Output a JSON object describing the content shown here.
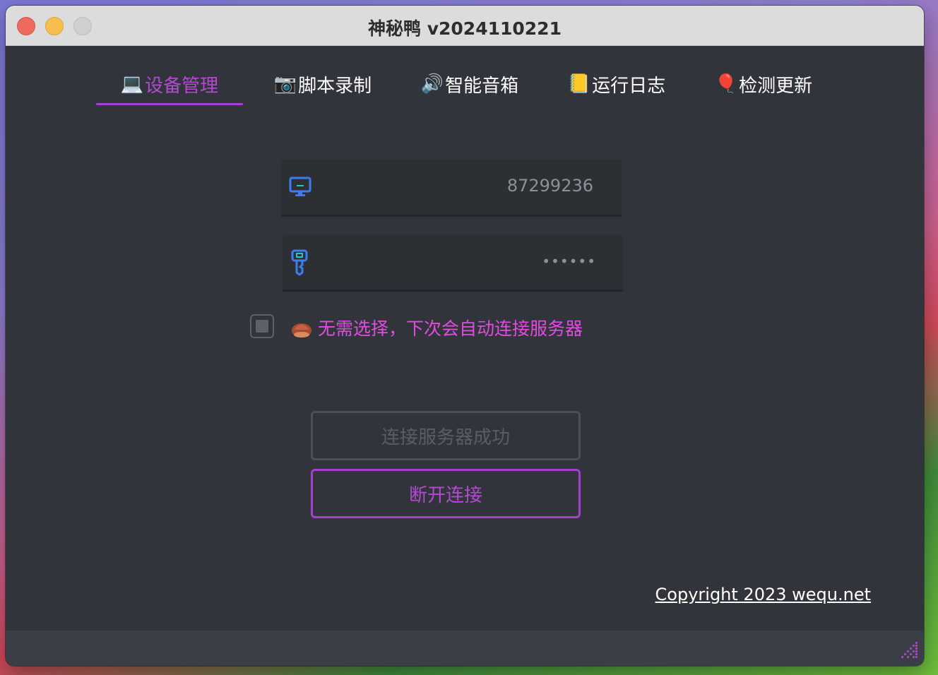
{
  "window": {
    "title": "神秘鸭 v2024110221"
  },
  "tabs": [
    {
      "label": "设备管理",
      "icon": "laptop-icon",
      "glyph": "💻",
      "active": true
    },
    {
      "label": "脚本录制",
      "icon": "camera-icon",
      "glyph": "📷",
      "active": false
    },
    {
      "label": "智能音箱",
      "icon": "speaker-icon",
      "glyph": "🔊",
      "active": false
    },
    {
      "label": "运行日志",
      "icon": "notebook-icon",
      "glyph": "📒",
      "active": false
    },
    {
      "label": "检测更新",
      "icon": "balloon-icon",
      "glyph": "🎈",
      "active": false
    }
  ],
  "form": {
    "device_id": {
      "value": "87299236",
      "icon": "monitor-icon"
    },
    "password": {
      "value": "••••••",
      "icon": "key-icon"
    },
    "auto_connect": {
      "checked": false,
      "label": "无需选择，下次会自动连接服务器",
      "icon": "chestnut-icon"
    }
  },
  "buttons": {
    "status_label": "连接服务器成功",
    "disconnect_label": "断开连接"
  },
  "footer": {
    "copyright": "Copyright 2023 wequ.net"
  },
  "colors": {
    "accent": "#a63fcf",
    "accent_text": "#b24ad0",
    "label_magenta": "#e04ce0",
    "window_bg": "#31353b",
    "icon_blue": "#3d7cf0"
  }
}
